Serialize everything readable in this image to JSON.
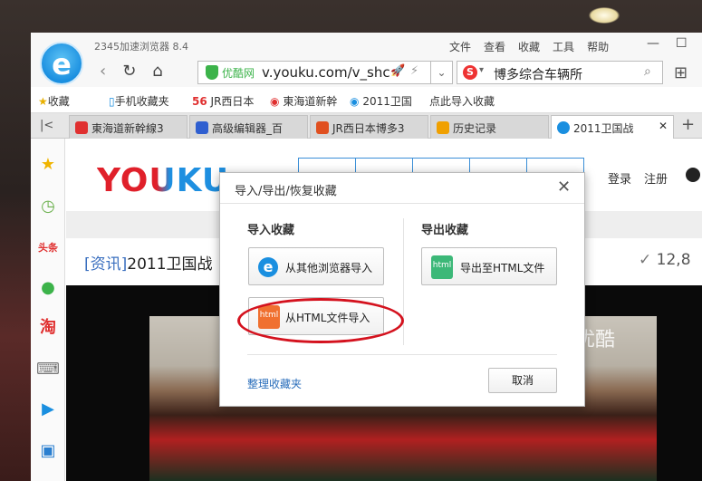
{
  "browser": {
    "app_name": "2345加速浏览器 8.4",
    "logo_letter": "e",
    "menu": [
      "文件",
      "查看",
      "收藏",
      "工具",
      "帮助"
    ],
    "window_controls": [
      "minimize-icon",
      "maximize-icon",
      "close-icon"
    ],
    "nav": {
      "back": "‹",
      "refresh": "↻",
      "home": "⌂"
    },
    "address": {
      "site_name": "优酷网",
      "url": "v.youku.com/v_shc"
    },
    "search": {
      "engine_letter": "S",
      "query": "博多综合车辆所"
    },
    "bookmarks": [
      "收藏",
      "手机收藏夹",
      "JR西日本",
      "東海道新幹",
      "2011卫国",
      "点此导入收藏"
    ],
    "tabs": [
      {
        "label": "東海道新幹線3",
        "color": "#e03030",
        "active": false
      },
      {
        "label": "高级编辑器_百",
        "color": "#2f5fd0",
        "active": false
      },
      {
        "label": "JR西日本博多3",
        "color": "#e05020",
        "active": false
      },
      {
        "label": "历史记录",
        "color": "#f0a000",
        "active": false
      },
      {
        "label": "2011卫国战",
        "color": "#1a8fe0",
        "active": true
      }
    ]
  },
  "page": {
    "logo": "YOUKU",
    "login": "登录",
    "register": "注册",
    "news_tag": "[资讯]",
    "news_title": "2011卫国战",
    "view_count": "12,8",
    "watermark": "优酷"
  },
  "dialog": {
    "title": "导入/导出/恢复收藏",
    "import_title": "导入收藏",
    "export_title": "导出收藏",
    "import_other": "从其他浏览器导入",
    "import_html": "从HTML文件导入",
    "export_html": "导出至HTML文件",
    "html_icon_text": "html",
    "organize": "整理收藏夹",
    "cancel": "取消"
  },
  "colors": {
    "accent_blue": "#1a8fe0",
    "annotation_red": "#d4121e",
    "html_icon_orange": "#f07030",
    "html_icon_green": "#3cb878"
  }
}
